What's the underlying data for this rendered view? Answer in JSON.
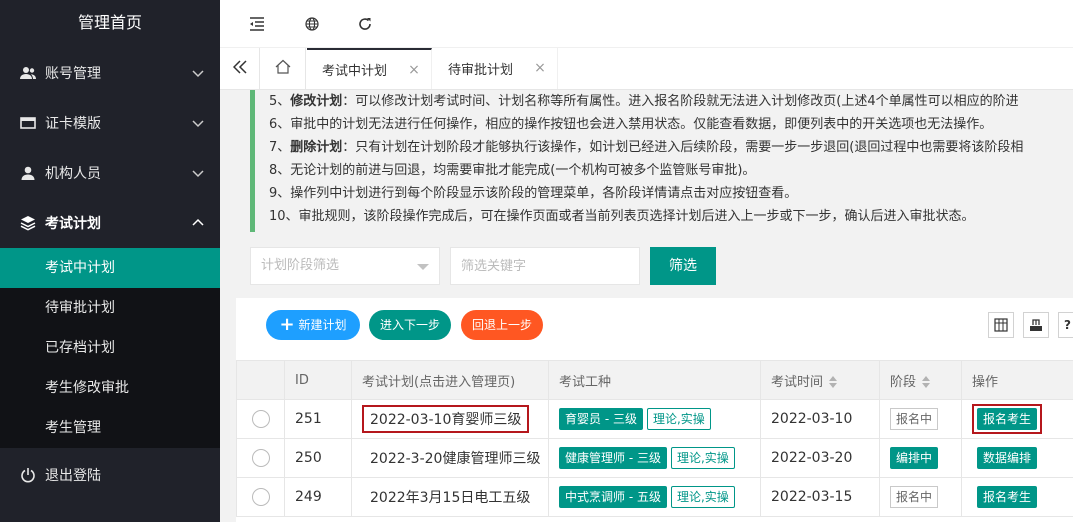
{
  "sidebar": {
    "brand": "管理首页",
    "items": [
      {
        "label": "账号管理",
        "icon": "users-icon"
      },
      {
        "label": "证卡模版",
        "icon": "card-icon"
      },
      {
        "label": "机构人员",
        "icon": "person-icon"
      },
      {
        "label": "考试计划",
        "icon": "layers-icon"
      }
    ],
    "sub_items": [
      {
        "label": "考试中计划",
        "active": true
      },
      {
        "label": "待审批计划"
      },
      {
        "label": "已存档计划"
      },
      {
        "label": "考生修改审批"
      },
      {
        "label": "考生管理"
      }
    ],
    "logout": "退出登陆"
  },
  "tabs": [
    {
      "label": "考试中计划",
      "active": true
    },
    {
      "label": "待审批计划"
    }
  ],
  "notes": [
    {
      "num": "5、",
      "bold": "修改计划",
      "text": "：可以修改计划考试时间、计划名称等所有属性。进入报名阶段就无法进入计划修改页(上述4个单属性可以相应的阶进"
    },
    {
      "num": "6、",
      "bold": "",
      "text": "审批中的计划无法进行任何操作，相应的操作按钮也会进入禁用状态。仅能查看数据，即便列表中的开关选项也无法操作。"
    },
    {
      "num": "7、",
      "bold": "删除计划",
      "text": "：只有计划在计划阶段才能够执行该操作，如计划已经进入后续阶段，需要一步一步退回(退回过程中也需要将该阶段相"
    },
    {
      "num": "8、",
      "bold": "",
      "text": "无论计划的前进与回退，均需要审批才能完成(一个机构可被多个监管账号审批)。"
    },
    {
      "num": "9、",
      "bold": "",
      "text": "操作列中计划进行到每个阶段显示该阶段的管理菜单，各阶段详情请点击对应按钮查看。"
    },
    {
      "num": "10、",
      "bold": "",
      "text": "审批规则，该阶段操作完成后，可在操作页面或者当前列表页选择计划后进入上一步或下一步，确认后进入审批状态。"
    }
  ],
  "filters": {
    "stage_placeholder": "计划阶段筛选",
    "keyword_placeholder": "筛选关键字",
    "button": "筛选"
  },
  "toolbar": {
    "new_plan": "新建计划",
    "next_step": "进入下一步",
    "prev_step": "回退上一步"
  },
  "table": {
    "headers": [
      "",
      "ID",
      "考试计划(点击进入管理页)",
      "考试工种",
      "考试时间",
      "阶段",
      "操作"
    ],
    "rows": [
      {
        "id": "251",
        "name": "2022-03-10育婴师三级",
        "job": "育婴员 - 三级",
        "mode": "理论,实操",
        "date": "2022-03-10",
        "stage": "报名中",
        "stage_style": "gray",
        "op": "报名考生"
      },
      {
        "id": "250",
        "name": "2022-3-20健康管理师三级",
        "job": "健康管理师 - 三级",
        "mode": "理论,实操",
        "date": "2022-03-20",
        "stage": "编排中",
        "stage_style": "green",
        "op": "数据编排"
      },
      {
        "id": "249",
        "name": "2022年3月15日电工五级",
        "job": "中式烹调师 - 五级",
        "mode": "理论,实操",
        "date": "2022-03-15",
        "stage": "报名中",
        "stage_style": "gray",
        "op": "报名考生"
      }
    ]
  },
  "colors": {
    "accent": "#009688",
    "sidebar": "#20222a",
    "blue": "#1e9fff",
    "orange": "#ff5722",
    "highlight": "#b5171c"
  }
}
